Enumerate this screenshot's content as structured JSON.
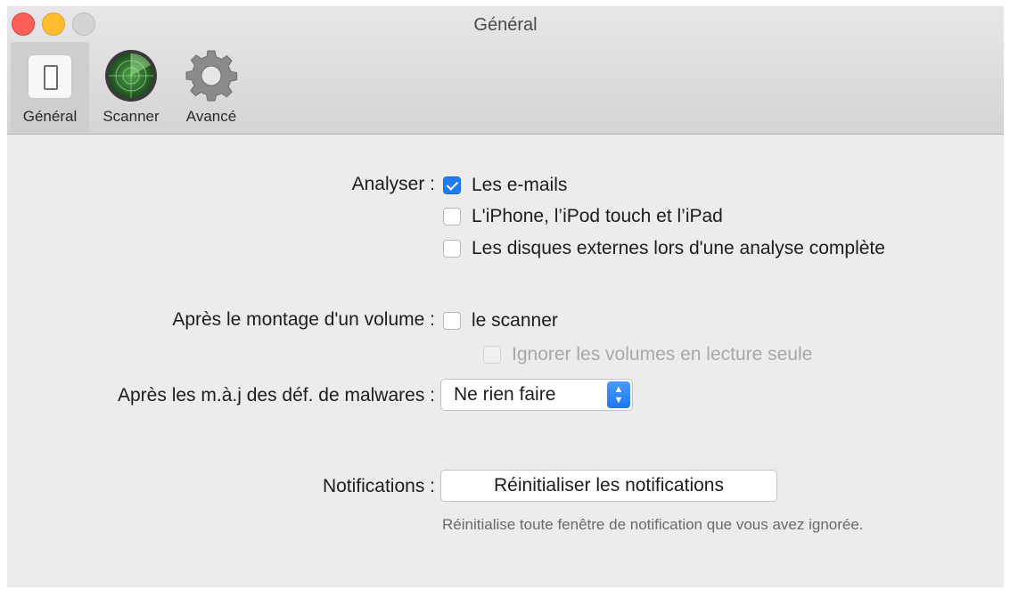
{
  "window": {
    "title": "Général"
  },
  "toolbar": {
    "tabs": [
      {
        "label": "Général",
        "icon": "general-switch-icon",
        "active": true
      },
      {
        "label": "Scanner",
        "icon": "radar-icon",
        "active": false
      },
      {
        "label": "Avancé",
        "icon": "gear-icon",
        "active": false
      }
    ]
  },
  "analyse": {
    "label": "Analyser :",
    "options": [
      {
        "label": "Les e-mails",
        "checked": true
      },
      {
        "label": "L'iPhone, l’iPod touch et l’iPad",
        "checked": false
      },
      {
        "label": "Les disques externes lors d'une analyse complète",
        "checked": false
      }
    ]
  },
  "volume": {
    "label": "Après le montage d'un volume :",
    "scan_label": "le scanner",
    "ignore_readonly_label": "Ignorer les volumes en lecture seule"
  },
  "malware_updates": {
    "label": "Après les m.à.j des déf. de malwares :",
    "selected": "Ne rien faire"
  },
  "notifications": {
    "label": "Notifications :",
    "reset_button": "Réinitialiser les notifications",
    "help_text": "Réinitialise toute fenêtre de notification que vous avez ignorée."
  },
  "colors": {
    "accent": "#1f7cf3",
    "close": "#fc5f57",
    "minimize": "#fdbd2e",
    "zoom_disabled": "#d4d3d4"
  }
}
